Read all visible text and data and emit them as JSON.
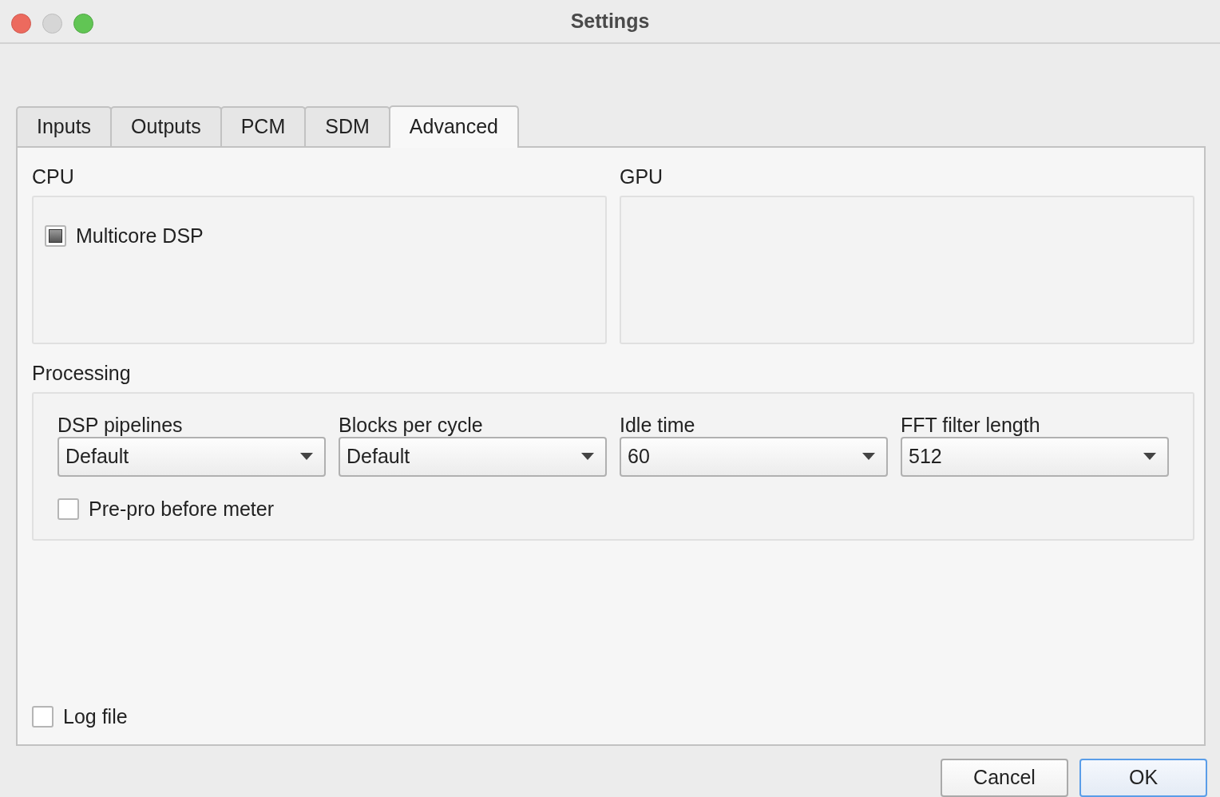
{
  "window": {
    "title": "Settings"
  },
  "tabs": [
    {
      "label": "Inputs",
      "selected": false
    },
    {
      "label": "Outputs",
      "selected": false
    },
    {
      "label": "PCM",
      "selected": false
    },
    {
      "label": "SDM",
      "selected": false
    },
    {
      "label": "Advanced",
      "selected": true
    }
  ],
  "cpu": {
    "title": "CPU",
    "options": [
      {
        "label": "Multicore DSP",
        "checked": true
      }
    ]
  },
  "gpu": {
    "title": "GPU"
  },
  "processing": {
    "title": "Processing",
    "selects": [
      {
        "label": "DSP pipelines",
        "value": "Default"
      },
      {
        "label": "Blocks per cycle",
        "value": "Default"
      },
      {
        "label": "Idle time",
        "value": "60"
      },
      {
        "label": "FFT filter length",
        "value": "512"
      }
    ],
    "options": [
      {
        "label": "Pre-pro before meter",
        "checked": false
      }
    ]
  },
  "log_file": {
    "label": "Log file",
    "checked": false
  },
  "buttons": [
    {
      "label": "Cancel",
      "default": false
    },
    {
      "label": "OK",
      "default": true
    }
  ]
}
